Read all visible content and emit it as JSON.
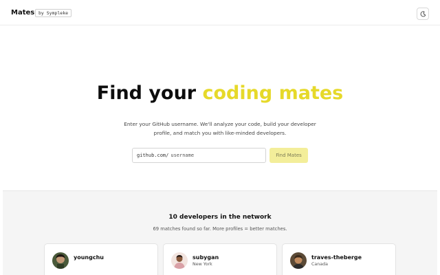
{
  "header": {
    "brand": "Mates",
    "by_badge": "by Sympleke",
    "theme_toggle_icon": "moon-icon"
  },
  "hero": {
    "title_prefix": "Find your ",
    "title_accent": "coding mates",
    "accent_color": "#e6d92a",
    "description": "Enter your GitHub username. We'll analyze your code, build your developer profile, and match you with like-minded developers.",
    "input_prefix": "github.com/",
    "input_placeholder": "username",
    "input_value": "",
    "button_label": "Find Mates",
    "button_color": "#f3ee9a"
  },
  "network": {
    "title": "10 developers in the network",
    "subtitle": "69 matches found so far. More profiles = better matches.",
    "developers": [
      {
        "username": "youngchu",
        "location": ""
      },
      {
        "username": "subygan",
        "location": "New York"
      },
      {
        "username": "traves-theberge",
        "location": "Canada"
      }
    ]
  }
}
